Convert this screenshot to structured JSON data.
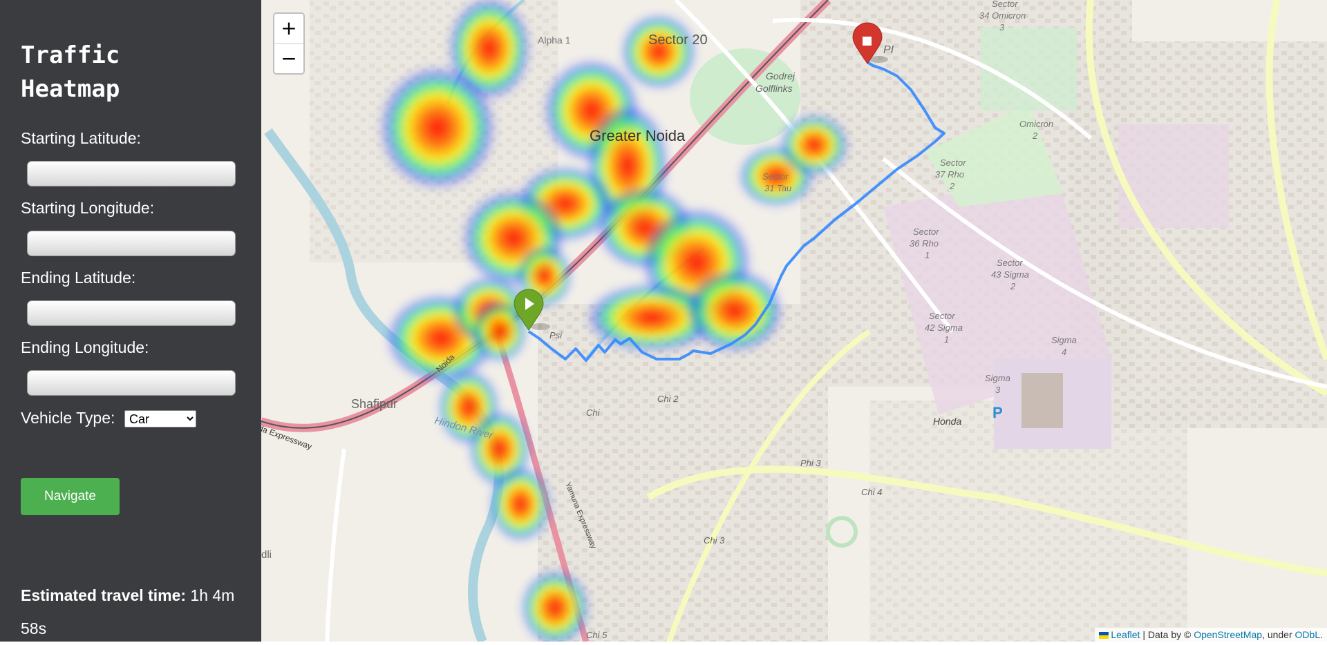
{
  "sidebar": {
    "title": "Traffic Heatmap",
    "start_lat_label": "Starting Latitude:",
    "start_lat_value": "",
    "start_lng_label": "Starting Longitude:",
    "start_lng_value": "",
    "end_lat_label": "Ending Latitude:",
    "end_lat_value": "",
    "end_lng_label": "Ending Longitude:",
    "end_lng_value": "",
    "vehicle_label": "Vehicle Type:",
    "vehicle_selected": "Car",
    "navigate_label": "Navigate",
    "eta_label": "Estimated travel time:",
    "eta_value": "1h 4m 58s"
  },
  "map": {
    "zoom_in": "+",
    "zoom_out": "−",
    "labels": {
      "sector20": "Sector 20",
      "alpha1": "Alpha 1",
      "greater_noida": "Greater Noida",
      "godrej": "Godrej",
      "golflinks": "Golflinks",
      "pi": "PI",
      "sector34a": "Sector",
      "sector34b": "34 Omicron",
      "sector34c": "3",
      "omicron2a": "Omicron",
      "omicron2b": "2",
      "sector37a": "Sector",
      "sector37b": "37 Rho",
      "sector37c": "2",
      "sector31a": "Sector",
      "sector31b": "31 Tau",
      "sector36a": "Sector",
      "sector36b": "36 Rho",
      "sector36c": "1",
      "sector43a": "Sector",
      "sector43b": "43 Sigma",
      "sector43c": "2",
      "sector42a": "Sector",
      "sector42b": "42 Sigma",
      "sector42c": "1",
      "sigma4a": "Sigma",
      "sigma4b": "4",
      "sigma3a": "Sigma",
      "sigma3b": "3",
      "psi": "Psi",
      "shafipur": "Shafipur",
      "hindon": "Hindon River",
      "chi": "Chi",
      "chi2": "Chi 2",
      "phi3": "Phi 3",
      "chi4": "Chi 4",
      "chi3": "Chi 3",
      "chi5": "Chi 5",
      "honda": "Honda",
      "parking": "P",
      "expressway": "da Expressway",
      "dli": "dli",
      "yamuna": "Yamuna Expressway",
      "noida": "Noida"
    },
    "attribution": {
      "leaflet": "Leaflet",
      "sep": " | Data by © ",
      "osm": "OpenStreetMap",
      "under": ", under ",
      "odbl": "ODbL",
      "end": "."
    },
    "colors": {
      "route": "#3388ff",
      "start_marker": "#6ea628",
      "end_marker": "#d3362d",
      "heat_core": "#ff0000",
      "heat_mid": "#ffff00",
      "heat_edge": "#00ffaa",
      "heat_outer": "#0000ff"
    }
  },
  "vehicle_options": [
    "Car"
  ]
}
